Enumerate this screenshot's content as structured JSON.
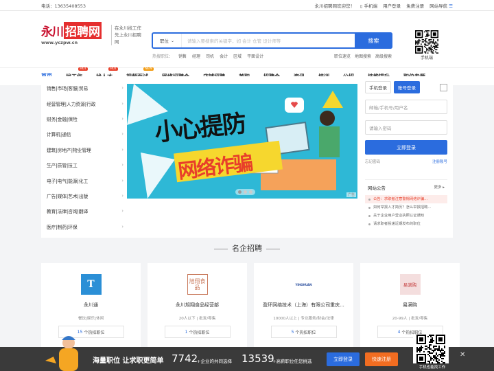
{
  "topbar": {
    "phone": "电话：13635408553",
    "welcome": "永川招聘网欢迎您！",
    "mobile": "手机端",
    "login": "用户登录",
    "register": "免费注册",
    "sitenav": "网站导航"
  },
  "logo": {
    "name_a": "永川",
    "name_b": "招聘网",
    "url": "www.yczpw.cn",
    "slogan1": "在永川找工作",
    "slogan2": "先上永川招聘网"
  },
  "search": {
    "type": "职位",
    "placeholder": "请输入要搜索的关键字，如 会计 仓管 设计师等",
    "button": "搜索"
  },
  "hot": {
    "label": "热搜职位：",
    "items": [
      "销售",
      "经理",
      "司机",
      "会计",
      "区域",
      "平面设计"
    ]
  },
  "adv": [
    "职位速览",
    "地图搜索",
    "高级搜索"
  ],
  "qr_label": "手机端",
  "nav": [
    {
      "label": "首页",
      "badge": ""
    },
    {
      "label": "找工作",
      "badge": "HOT"
    },
    {
      "label": "找人才",
      "badge": "HOT"
    },
    {
      "label": "视频面试",
      "badge": "NEW"
    },
    {
      "label": "网络招聘会",
      "badge": ""
    },
    {
      "label": "店铺招聘",
      "badge": ""
    },
    {
      "label": "兼职",
      "badge": ""
    },
    {
      "label": "招聘会",
      "badge": ""
    },
    {
      "label": "资讯",
      "badge": ""
    },
    {
      "label": "培训",
      "badge": ""
    },
    {
      "label": "公招",
      "badge": ""
    },
    {
      "label": "技能提升",
      "badge": ""
    },
    {
      "label": "职位专题",
      "badge": ""
    }
  ],
  "categories": [
    "销售|市场|客服|贸易",
    "经营管理|人力资源|行政",
    "财务|金融|保险",
    "计算机|通信",
    "建筑|房地产|物业管理",
    "生产|质管|技工",
    "电子|电气|能源|化工",
    "广告|媒体|艺术|出版",
    "教育|法律|咨询|翻译",
    "医疗|制药|环保"
  ],
  "banner": {
    "line1": "小心提防",
    "line2": "网络诈骗",
    "ad": "广告"
  },
  "login": {
    "tab_mobile": "手机登录",
    "tab_account": "账号登录",
    "user_placeholder": "邮箱/手机号/用户名",
    "pwd_placeholder": "请输入密码",
    "submit": "立即登录",
    "forgot": "忘记密码",
    "register": "注册账号"
  },
  "notice": {
    "title": "网站公告",
    "more": "更多 ▸",
    "items": [
      "公告：求职者注意警惕网络诈骗...",
      "如何举报人才简历？怎么举报招聘...",
      "关于企业用户营业执照认证通知",
      "请求职者投递近期发布的职位"
    ]
  },
  "section_title": "名企招聘",
  "companies": [
    {
      "name": "永川通",
      "logo": "T",
      "meta": "餐饮|娱乐|休闲",
      "jobs": "15",
      "job_suffix": "个热招职位",
      "color": "#2b8fd6"
    },
    {
      "name": "永川旭翔食品经营部",
      "logo": "旭翔食品",
      "meta": "20人以下 | 批发/零售",
      "jobs": "1",
      "job_suffix": "个热招职位",
      "color": "#c97a5c"
    },
    {
      "name": "盈环网络技术（上海）有限公司重庆...",
      "logo": "YINGHUAN",
      "meta": "10000人以上 | 专业服务/财会/法律",
      "jobs": "5",
      "job_suffix": "个热招职位",
      "color": "#2b4f9e"
    },
    {
      "name": "易满购",
      "logo": "易满购",
      "meta": "20-99人 | 批发/零售",
      "jobs": "4",
      "job_suffix": "个热招职位",
      "color": "#c43e3e"
    }
  ],
  "footbar": {
    "slogan": "海量职位 让求职更简单",
    "num1": "7742",
    "txt1": "+企业的共同选择",
    "num2": "13539",
    "txt2": "+高薪职位任您挑选",
    "login": "立即登录",
    "register": "快速注册",
    "qr_label": "手机也能找工作"
  }
}
